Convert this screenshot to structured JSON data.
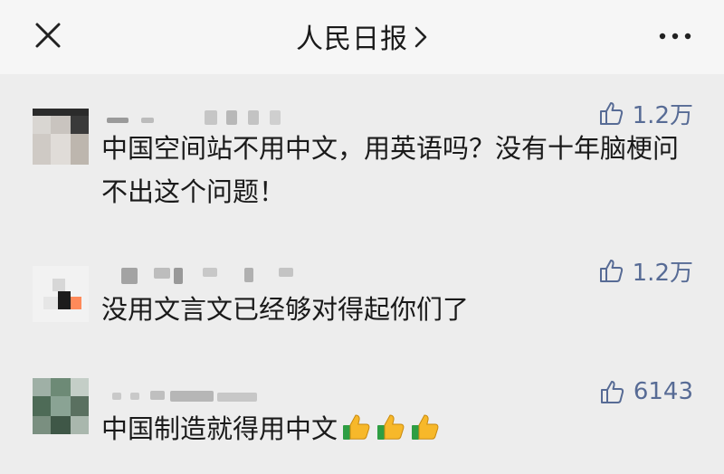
{
  "header": {
    "title": "人民日报"
  },
  "comments": [
    {
      "likes": "1.2万",
      "text": "中国空间站不用中文，用英语吗？没有十年脑梗问不出这个问题！"
    },
    {
      "likes": "1.2万",
      "text": "没用文言文已经够对得起你们了"
    },
    {
      "likes": "6143",
      "text": "中国制造就得用中文",
      "emojis": [
        "thumbs-up",
        "thumbs-up",
        "thumbs-up"
      ]
    }
  ],
  "colors": {
    "like_blue": "#576b95",
    "background": "#ededed",
    "navbar": "#f6f6f6"
  }
}
